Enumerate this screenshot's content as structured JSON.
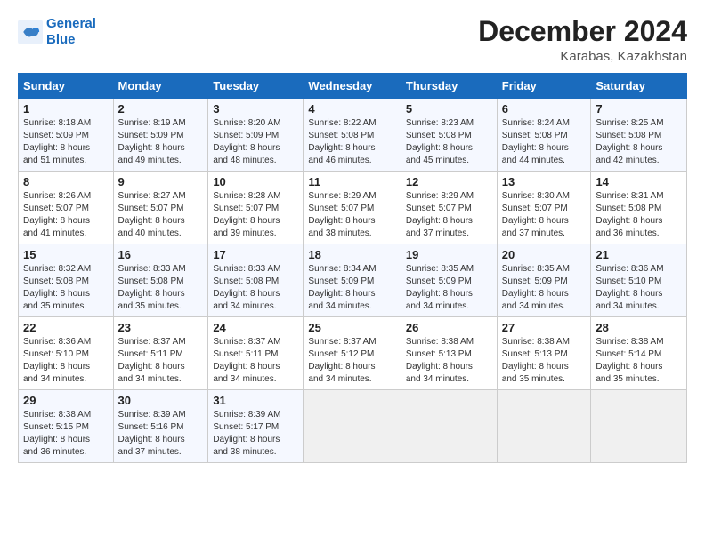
{
  "logo": {
    "line1": "General",
    "line2": "Blue"
  },
  "title": "December 2024",
  "location": "Karabas, Kazakhstan",
  "days_of_week": [
    "Sunday",
    "Monday",
    "Tuesday",
    "Wednesday",
    "Thursday",
    "Friday",
    "Saturday"
  ],
  "weeks": [
    [
      {
        "day": "1",
        "sunrise": "8:18 AM",
        "sunset": "5:09 PM",
        "daylight": "8 hours and 51 minutes."
      },
      {
        "day": "2",
        "sunrise": "8:19 AM",
        "sunset": "5:09 PM",
        "daylight": "8 hours and 49 minutes."
      },
      {
        "day": "3",
        "sunrise": "8:20 AM",
        "sunset": "5:09 PM",
        "daylight": "8 hours and 48 minutes."
      },
      {
        "day": "4",
        "sunrise": "8:22 AM",
        "sunset": "5:08 PM",
        "daylight": "8 hours and 46 minutes."
      },
      {
        "day": "5",
        "sunrise": "8:23 AM",
        "sunset": "5:08 PM",
        "daylight": "8 hours and 45 minutes."
      },
      {
        "day": "6",
        "sunrise": "8:24 AM",
        "sunset": "5:08 PM",
        "daylight": "8 hours and 44 minutes."
      },
      {
        "day": "7",
        "sunrise": "8:25 AM",
        "sunset": "5:08 PM",
        "daylight": "8 hours and 42 minutes."
      }
    ],
    [
      {
        "day": "8",
        "sunrise": "8:26 AM",
        "sunset": "5:07 PM",
        "daylight": "8 hours and 41 minutes."
      },
      {
        "day": "9",
        "sunrise": "8:27 AM",
        "sunset": "5:07 PM",
        "daylight": "8 hours and 40 minutes."
      },
      {
        "day": "10",
        "sunrise": "8:28 AM",
        "sunset": "5:07 PM",
        "daylight": "8 hours and 39 minutes."
      },
      {
        "day": "11",
        "sunrise": "8:29 AM",
        "sunset": "5:07 PM",
        "daylight": "8 hours and 38 minutes."
      },
      {
        "day": "12",
        "sunrise": "8:29 AM",
        "sunset": "5:07 PM",
        "daylight": "8 hours and 37 minutes."
      },
      {
        "day": "13",
        "sunrise": "8:30 AM",
        "sunset": "5:07 PM",
        "daylight": "8 hours and 37 minutes."
      },
      {
        "day": "14",
        "sunrise": "8:31 AM",
        "sunset": "5:08 PM",
        "daylight": "8 hours and 36 minutes."
      }
    ],
    [
      {
        "day": "15",
        "sunrise": "8:32 AM",
        "sunset": "5:08 PM",
        "daylight": "8 hours and 35 minutes."
      },
      {
        "day": "16",
        "sunrise": "8:33 AM",
        "sunset": "5:08 PM",
        "daylight": "8 hours and 35 minutes."
      },
      {
        "day": "17",
        "sunrise": "8:33 AM",
        "sunset": "5:08 PM",
        "daylight": "8 hours and 34 minutes."
      },
      {
        "day": "18",
        "sunrise": "8:34 AM",
        "sunset": "5:09 PM",
        "daylight": "8 hours and 34 minutes."
      },
      {
        "day": "19",
        "sunrise": "8:35 AM",
        "sunset": "5:09 PM",
        "daylight": "8 hours and 34 minutes."
      },
      {
        "day": "20",
        "sunrise": "8:35 AM",
        "sunset": "5:09 PM",
        "daylight": "8 hours and 34 minutes."
      },
      {
        "day": "21",
        "sunrise": "8:36 AM",
        "sunset": "5:10 PM",
        "daylight": "8 hours and 34 minutes."
      }
    ],
    [
      {
        "day": "22",
        "sunrise": "8:36 AM",
        "sunset": "5:10 PM",
        "daylight": "8 hours and 34 minutes."
      },
      {
        "day": "23",
        "sunrise": "8:37 AM",
        "sunset": "5:11 PM",
        "daylight": "8 hours and 34 minutes."
      },
      {
        "day": "24",
        "sunrise": "8:37 AM",
        "sunset": "5:11 PM",
        "daylight": "8 hours and 34 minutes."
      },
      {
        "day": "25",
        "sunrise": "8:37 AM",
        "sunset": "5:12 PM",
        "daylight": "8 hours and 34 minutes."
      },
      {
        "day": "26",
        "sunrise": "8:38 AM",
        "sunset": "5:13 PM",
        "daylight": "8 hours and 34 minutes."
      },
      {
        "day": "27",
        "sunrise": "8:38 AM",
        "sunset": "5:13 PM",
        "daylight": "8 hours and 35 minutes."
      },
      {
        "day": "28",
        "sunrise": "8:38 AM",
        "sunset": "5:14 PM",
        "daylight": "8 hours and 35 minutes."
      }
    ],
    [
      {
        "day": "29",
        "sunrise": "8:38 AM",
        "sunset": "5:15 PM",
        "daylight": "8 hours and 36 minutes."
      },
      {
        "day": "30",
        "sunrise": "8:39 AM",
        "sunset": "5:16 PM",
        "daylight": "8 hours and 37 minutes."
      },
      {
        "day": "31",
        "sunrise": "8:39 AM",
        "sunset": "5:17 PM",
        "daylight": "8 hours and 38 minutes."
      },
      null,
      null,
      null,
      null
    ]
  ]
}
